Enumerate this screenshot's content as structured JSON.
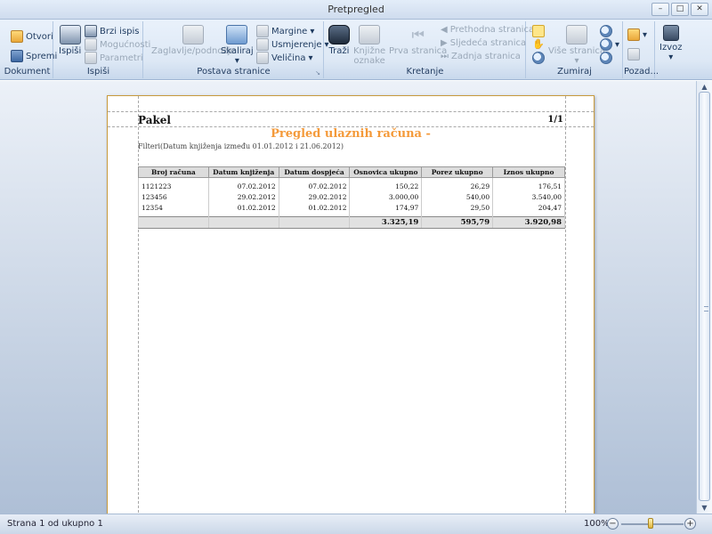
{
  "window": {
    "title": "Pretpregled",
    "min": "–",
    "max": "□",
    "close": "✕"
  },
  "ribbon": {
    "dokument": {
      "label": "Dokument",
      "open": "Otvori",
      "save": "Spremi"
    },
    "ispisi": {
      "label": "Ispiši",
      "print": "Ispiši",
      "quick_print": "Brzi ispis",
      "options": "Mogućnosti",
      "parameters": "Parametri"
    },
    "postava": {
      "label": "Postava stranice",
      "header_footer": "Zaglavlje/podnožje",
      "scale": "Skaliraj",
      "margins": "Margine",
      "orientation": "Usmjerenje",
      "size": "Veličina"
    },
    "kretanje": {
      "label": "Kretanje",
      "search": "Traži",
      "bookmarks_1": "Knjižne",
      "bookmarks_2": "oznake",
      "first_page": "Prva stranica",
      "prev_page": "Prethodna stranica",
      "next_page": "Sljedeća stranica",
      "last_page": "Zadnja stranica"
    },
    "zumiraj": {
      "label": "Zumiraj",
      "multi_page": "Više stranica"
    },
    "pozadina": {
      "label": "Pozad..."
    },
    "izvoz": {
      "label": "Izvoz"
    }
  },
  "report": {
    "company": "Pakel",
    "page": "1/1",
    "title": "Pregled ulaznih računa -",
    "filter": "Filteri(Datum knjiženja između 01.01.2012 i 21.06.2012)",
    "columns": [
      "Broj računa",
      "Datum knjiženja",
      "Datum dospjeća",
      "Osnovica ukupno",
      "Porez ukupno",
      "Iznos ukupno"
    ],
    "rows": [
      [
        "1121223",
        "07.02.2012",
        "07.02.2012",
        "150,22",
        "26,29",
        "176,51"
      ],
      [
        "123456",
        "29.02.2012",
        "29.02.2012",
        "3.000,00",
        "540,00",
        "3.540,00"
      ],
      [
        "12354",
        "01.02.2012",
        "01.02.2012",
        "174,97",
        "29,50",
        "204,47"
      ]
    ],
    "totals": [
      "3.325,19",
      "595,79",
      "3.920,98"
    ]
  },
  "status": {
    "page_info": "Strana 1 od ukupno 1",
    "zoom": "100%",
    "zoom_out": "−",
    "zoom_in": "+"
  }
}
